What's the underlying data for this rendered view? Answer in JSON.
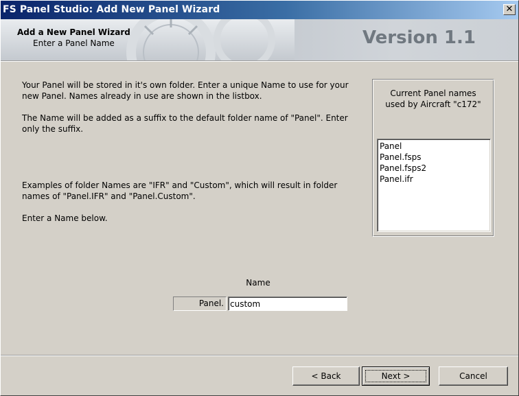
{
  "window": {
    "title": "FS Panel Studio: Add New Panel Wizard",
    "close_icon": "close-icon"
  },
  "banner": {
    "heading": "Add a New Panel Wizard",
    "subheading": "Enter a Panel Name",
    "version": "Version 1.1"
  },
  "instructions": {
    "para1": "Your Panel will be stored in it's own folder. Enter a unique Name to use for your new Panel. Names already in use are shown in the listbox.",
    "para2": "The Name will be added as a suffix to the default folder name of \"Panel\". Enter only the suffix.",
    "para3": "Examples of folder Names are \"IFR\" and \"Custom\", which will result in folder names of \"Panel.IFR\" and \"Panel.Custom\".",
    "para4": "Enter a Name below."
  },
  "existing_names": {
    "label_line1": "Current Panel names",
    "label_line2": "used by Aircraft \"c172\"",
    "items": [
      "Panel",
      "Panel.fsps",
      "Panel.fsps2",
      "Panel.ifr"
    ]
  },
  "name_entry": {
    "label": "Name",
    "prefix": "Panel.",
    "value": "custom"
  },
  "buttons": {
    "back": "< Back",
    "next": "Next >",
    "cancel": "Cancel"
  }
}
